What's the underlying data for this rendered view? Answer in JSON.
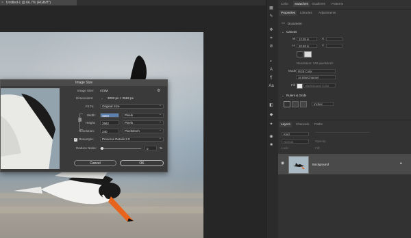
{
  "document_tab": {
    "title": "Untitled-1 @ 66.7% (RGB/8*)",
    "close": "×"
  },
  "dialog": {
    "title": "Image Size",
    "image_size_label": "Image Size:",
    "image_size_value": "472M",
    "dimensions_label": "Dimensions:",
    "dimensions_value": "3203 px × 2562 px",
    "fit_to_label": "Fit To:",
    "fit_to_value": "Original Size",
    "width_label": "Width:",
    "width_value": "3203",
    "width_unit": "Pixels",
    "height_label": "Height:",
    "height_value": "2562",
    "height_unit": "Pixels",
    "resolution_label": "Resolution:",
    "resolution_value": "240",
    "resolution_unit": "Pixels/Inch",
    "resample_label": "Resample:",
    "resample_value": "Preserve Details 2.0",
    "reduce_noise_label": "Reduce Noise:",
    "reduce_noise_value": "0",
    "reduce_noise_unit": "%",
    "cancel_label": "Cancel",
    "ok_label": "OK"
  },
  "top_panel": {
    "tabs": [
      "Color",
      "Swatches",
      "Gradients",
      "Patterns"
    ],
    "active": "Swatches"
  },
  "properties_panel": {
    "tabs": [
      "Properties",
      "Libraries",
      "Adjustments"
    ],
    "document_label": "Document",
    "canvas_header": "Canvas",
    "w_label": "W",
    "w_value": "13.35 in",
    "h_label": "H",
    "h_value": "10.68 in",
    "x_label": "X",
    "y_label": "Y",
    "resolution_text": "Resolution: 240 pixels/inch",
    "mode_label": "Mode",
    "mode_value": "RGB Color",
    "depth_value": "16 Bits/Channel",
    "fill_label": "Fill",
    "fill_value": "Background Color",
    "rulers_header": "Rulers & Grids",
    "rulers_unit": "Inches"
  },
  "layers_panel": {
    "tabs": [
      "Layers",
      "Channels",
      "Paths"
    ],
    "kind_label": "Kind",
    "mode_label": "Normal",
    "opacity_label": "Opacity:",
    "lock_label": "Lock:",
    "fill_label": "Fill:",
    "layer_name": "Background"
  },
  "colors": {
    "panel_bg": "#323232",
    "dialog_bg": "#3a3a3a",
    "selected_layer": "#4a4a4a",
    "bird_beak": "#e8641c"
  },
  "icons": [
    "close-icon",
    "gear-icon",
    "link-icon",
    "checkbox-icon",
    "eye-icon",
    "lock-icon",
    "disclosure-triangle-icon",
    "text-tool-icon",
    "brush-tool-icon",
    "move-tool-icon"
  ]
}
